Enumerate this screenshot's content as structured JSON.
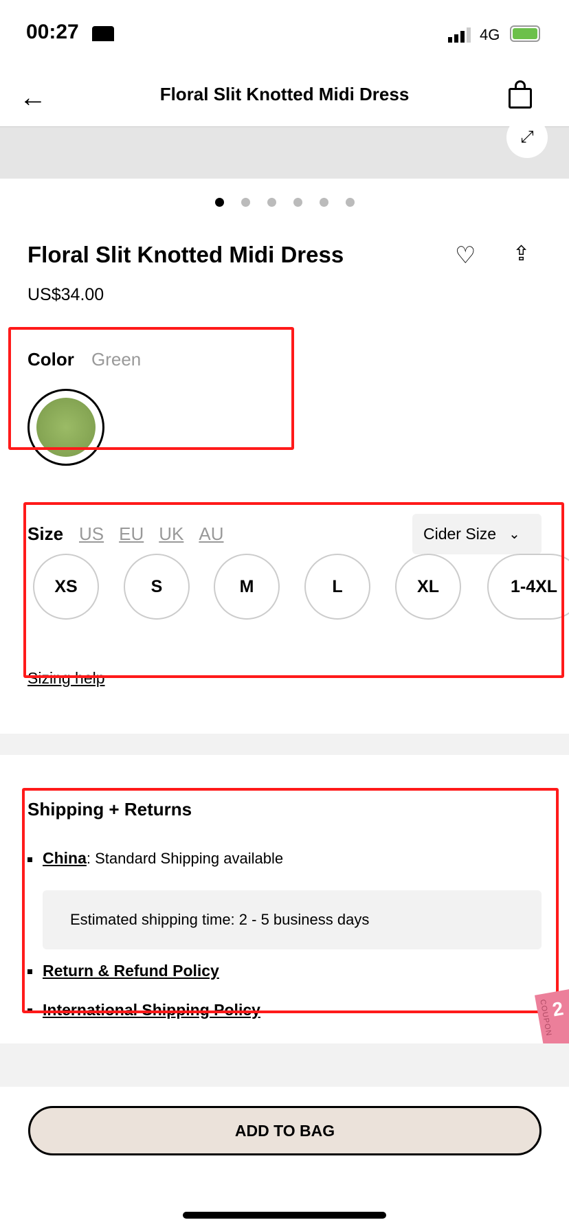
{
  "status": {
    "time": "00:27",
    "network": "4G"
  },
  "nav": {
    "title": "Floral Slit Knotted Midi Dress"
  },
  "carousel": {
    "count": 6,
    "active": 0
  },
  "product": {
    "title": "Floral Slit Knotted Midi Dress",
    "price": "US$34.00"
  },
  "color": {
    "label": "Color",
    "value": "Green",
    "swatch": "#8aab5a"
  },
  "size": {
    "label": "Size",
    "systems": [
      "US",
      "EU",
      "UK",
      "AU"
    ],
    "selector": "Cider Size",
    "options": [
      "XS",
      "S",
      "M",
      "L",
      "XL",
      "1-4XL"
    ],
    "help": "Sizing help"
  },
  "shipping": {
    "title": "Shipping + Returns",
    "country": "China",
    "country_suffix": ": Standard Shipping available",
    "estimate": "Estimated shipping time: 2 - 5 business days",
    "return_policy": "Return & Refund Policy",
    "intl_policy": "International Shipping Policy"
  },
  "coupon": {
    "text": "COUPON",
    "value": "2"
  },
  "cta": {
    "add_to_bag": "ADD TO BAG"
  }
}
